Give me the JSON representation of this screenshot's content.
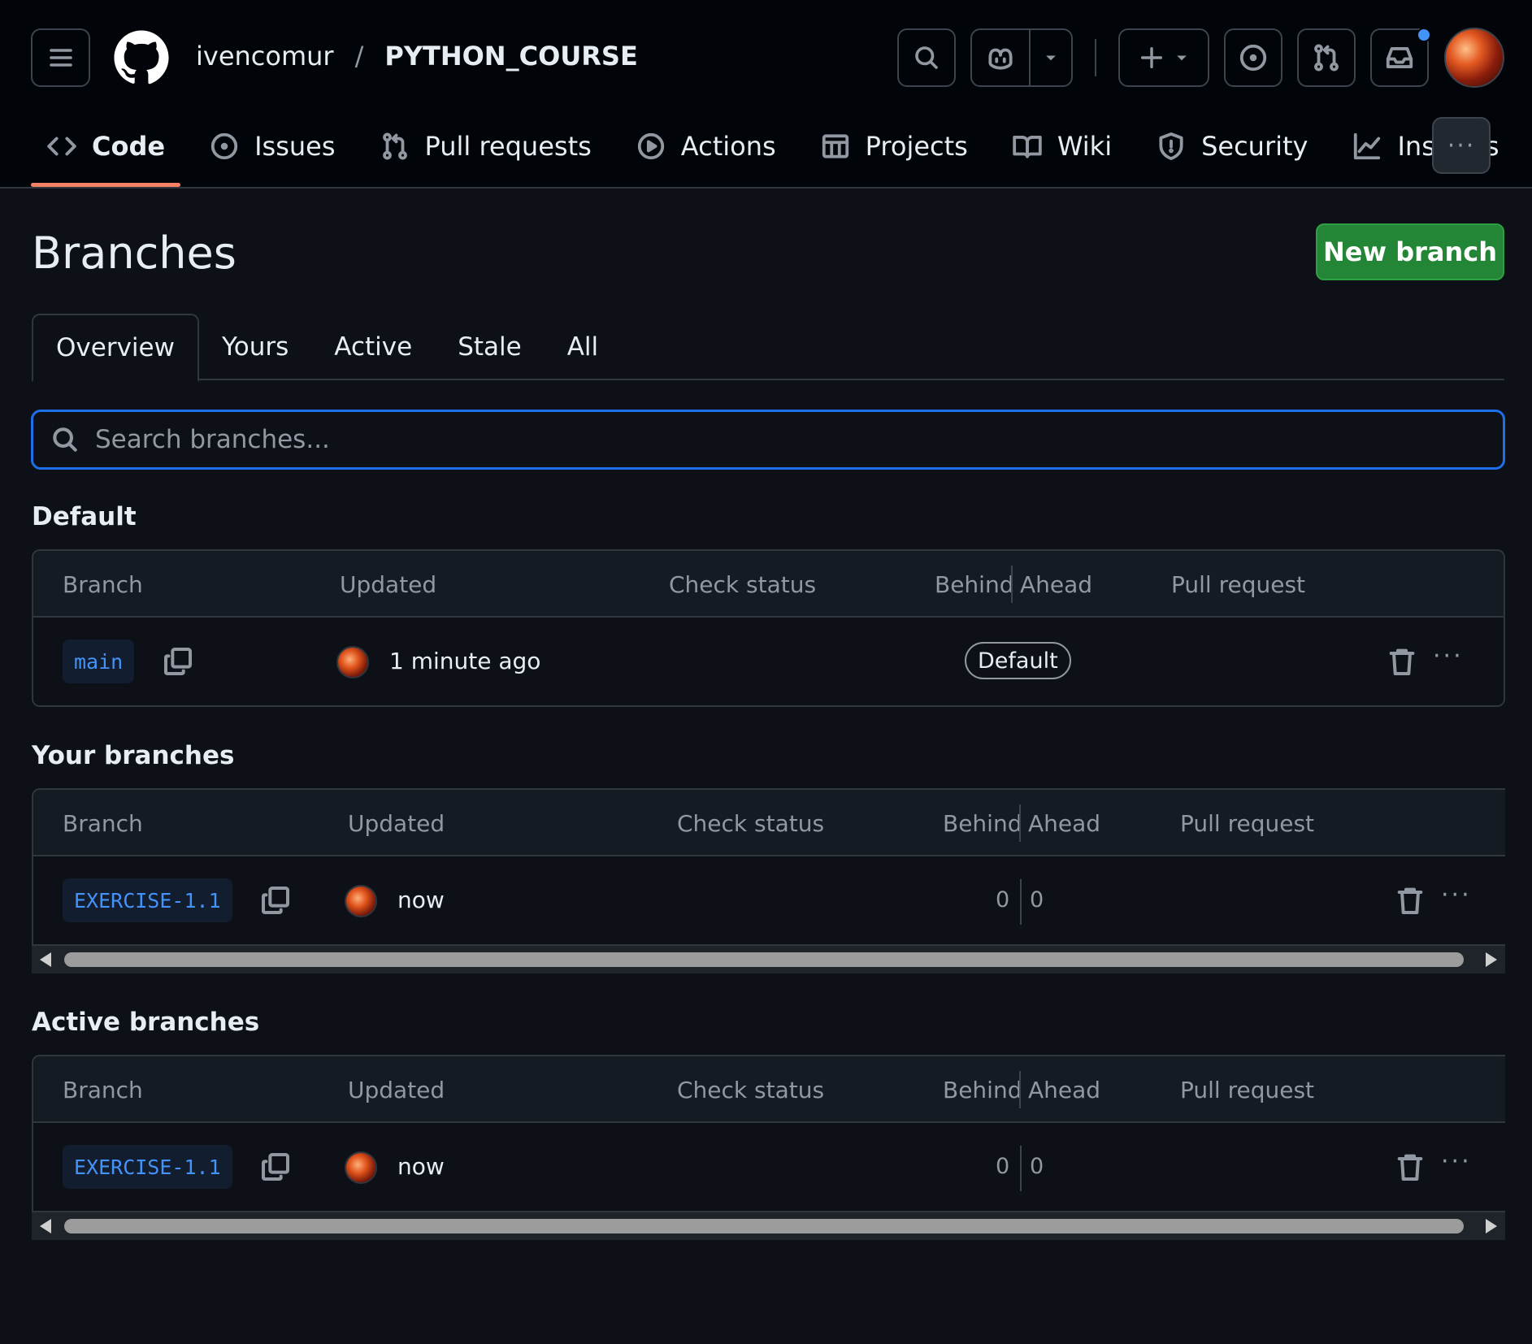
{
  "header": {
    "owner": "ivencomur",
    "separator": "/",
    "repo": "PYTHON_COURSE"
  },
  "nav": {
    "tabs": [
      {
        "label": "Code",
        "icon": "code-icon",
        "selected": true
      },
      {
        "label": "Issues",
        "icon": "issue-opened-icon"
      },
      {
        "label": "Pull requests",
        "icon": "git-pull-request-icon"
      },
      {
        "label": "Actions",
        "icon": "play-icon"
      },
      {
        "label": "Projects",
        "icon": "table-icon"
      },
      {
        "label": "Wiki",
        "icon": "book-icon"
      },
      {
        "label": "Security",
        "icon": "shield-icon"
      },
      {
        "label": "Insights",
        "icon": "graph-icon"
      }
    ],
    "more": "···"
  },
  "page": {
    "title": "Branches",
    "new_branch_label": "New branch"
  },
  "subtabs": [
    "Overview",
    "Yours",
    "Active",
    "Stale",
    "All"
  ],
  "search": {
    "placeholder": "Search branches..."
  },
  "columns": {
    "branch": "Branch",
    "updated": "Updated",
    "check_status": "Check status",
    "behind": "Behind",
    "ahead": "Ahead",
    "pull_request": "Pull request"
  },
  "sections": {
    "default": {
      "title": "Default",
      "row": {
        "branch": "main",
        "updated": "1 minute ago",
        "badge": "Default"
      }
    },
    "yours": {
      "title": "Your branches",
      "row": {
        "branch": "EXERCISE-1.1",
        "updated": "now",
        "behind": "0",
        "ahead": "0"
      }
    },
    "active": {
      "title": "Active branches",
      "row": {
        "branch": "EXERCISE-1.1",
        "updated": "now",
        "behind": "0",
        "ahead": "0"
      }
    }
  },
  "colors": {
    "accent_blue": "#1f6feb",
    "primary_green": "#238636",
    "tab_underline": "#f78166",
    "notification": "#4493f8"
  }
}
